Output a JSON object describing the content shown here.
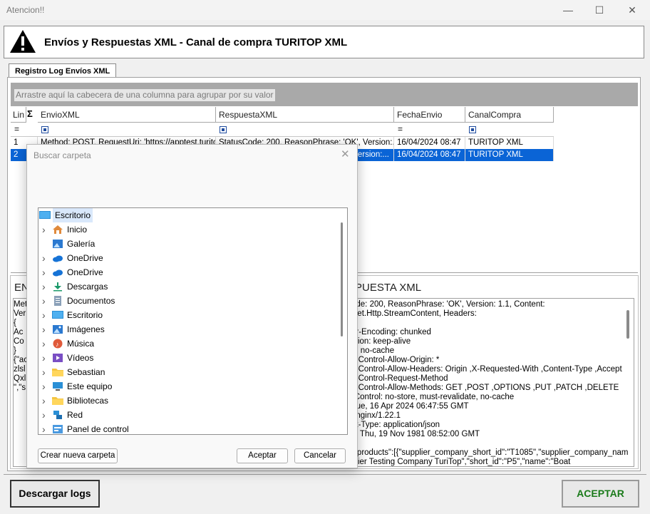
{
  "window": {
    "title": "Atencion!!"
  },
  "header": {
    "title": "Envíos y Respuestas XML - Canal de compra TURITOP XML"
  },
  "tab": {
    "label": "Registro Log Envíos XML"
  },
  "grid": {
    "group_hint": "Arrastre aquí la cabecera de una columna para agrupar por su valor",
    "columns": [
      "Lin",
      "EnvioXML",
      "RespuestaXML",
      "FechaEnvio",
      "CanalCompra"
    ],
    "filter_symbol": "=",
    "rows": [
      {
        "lin": "1",
        "envio": "Method: POST, RequestUri: 'https://apptest.turitop",
        "respuesta": "StatusCode: 200, ReasonPhrase: 'OK', Version:...",
        "fecha": "16/04/2024 08:47",
        "canal": "TURITOP XML"
      },
      {
        "lin": "2",
        "envio": "",
        "respuesta": "Version:...",
        "fecha": "16/04/2024 08:47",
        "canal": "TURITOP XML"
      }
    ]
  },
  "envio_panel": {
    "title_fragment": "EN",
    "lines": [
      "Met",
      "Ver",
      "{",
      "  Ac",
      "  Co",
      "}",
      "{\"ac",
      "zlsl",
      "Qxl",
      "\",\"s"
    ]
  },
  "respuesta_panel": {
    "title_fragment": "PUESTA XML",
    "lines": [
      "ode: 200, ReasonPhrase: 'OK', Version: 1.1, Content:",
      "Net.Http.StreamContent, Headers:",
      "",
      "er-Encoding: chunked",
      "ction: keep-alive",
      "a: no-cache",
      "s-Control-Allow-Origin: *",
      "s-Control-Allow-Headers: Origin ,X-Requested-With ,Content-Type ,Accept",
      "s-Control-Request-Method",
      "s-Control-Allow-Methods: GET ,POST ,OPTIONS ,PUT ,PATCH ,DELETE",
      "-Control: no-store, must-revalidate, no-cache",
      "Tue, 16 Apr 2024 06:47:55 GMT",
      ": nginx/1.22.1",
      "nt-Type: application/json",
      "s: Thu, 19 Nov 1981 08:52:00 GMT",
      "",
      "{\"products\":[{\"supplier_company_short_id\":\"T1085\",\"supplier_company_nam",
      "plier Testing Company TuriTop\",\"short_id\":\"P5\",\"name\":\"Boat"
    ]
  },
  "footer": {
    "download_label": "Descargar logs",
    "accept_label": "ACEPTAR",
    "accept_color": "#1a7a1a"
  },
  "dialog": {
    "title": "Buscar carpeta",
    "root": "Escritorio",
    "items": [
      {
        "label": "Inicio",
        "icon": "home-icon",
        "chevron": true
      },
      {
        "label": "Galería",
        "icon": "gallery-icon",
        "chevron": false
      },
      {
        "label": "OneDrive",
        "icon": "cloud-icon",
        "chevron": true
      },
      {
        "label": "OneDrive",
        "icon": "cloud-icon",
        "chevron": true
      },
      {
        "label": "Descargas",
        "icon": "download-icon",
        "chevron": true
      },
      {
        "label": "Documentos",
        "icon": "document-icon",
        "chevron": true
      },
      {
        "label": "Escritorio",
        "icon": "desktop-icon",
        "chevron": true
      },
      {
        "label": "Imágenes",
        "icon": "picture-icon",
        "chevron": true
      },
      {
        "label": "Música",
        "icon": "music-icon",
        "chevron": true
      },
      {
        "label": "Vídeos",
        "icon": "video-icon",
        "chevron": true
      },
      {
        "label": "Sebastian",
        "icon": "folder-icon",
        "chevron": true
      },
      {
        "label": "Este equipo",
        "icon": "computer-icon",
        "chevron": true
      },
      {
        "label": "Bibliotecas",
        "icon": "folder-icon",
        "chevron": true
      },
      {
        "label": "Red",
        "icon": "network-icon",
        "chevron": true
      },
      {
        "label": "Panel de control",
        "icon": "control-panel-icon",
        "chevron": true
      }
    ],
    "new_folder_label": "Crear nueva carpeta",
    "accept_label": "Aceptar",
    "cancel_label": "Cancelar"
  }
}
